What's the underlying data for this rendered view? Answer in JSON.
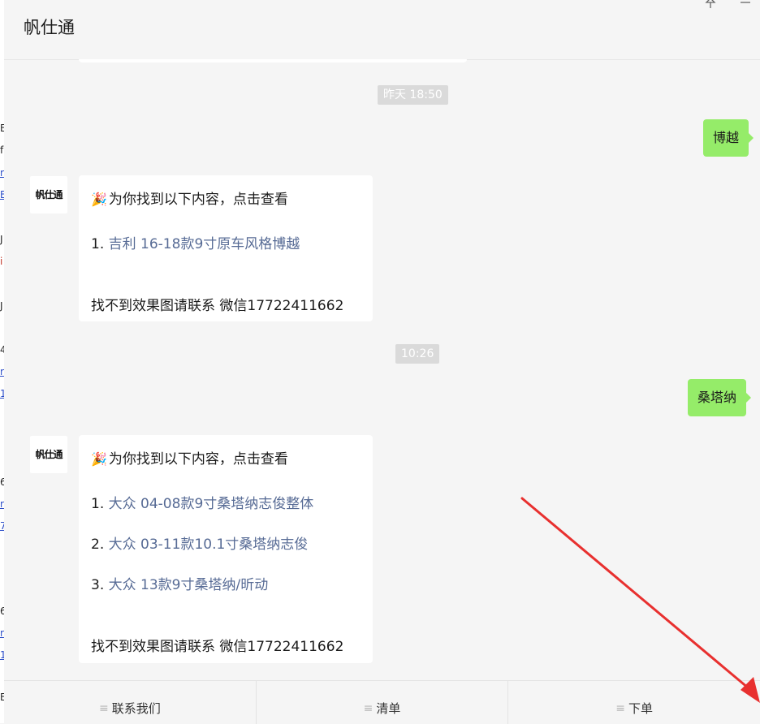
{
  "window": {
    "title": "帆仕通",
    "pin_icon": "pin-icon",
    "minimize_icon": "minimize-icon"
  },
  "left_strip": [
    {
      "text": "E",
      "style": "normal"
    },
    {
      "text": "f",
      "style": "normal"
    },
    {
      "text": "r",
      "style": "link"
    },
    {
      "text": "E",
      "style": "link"
    },
    {
      "text": "J",
      "style": "normal"
    },
    {
      "text": "i",
      "style": "red"
    },
    {
      "text": "J",
      "style": "normal"
    },
    {
      "text": "4",
      "style": "normal"
    },
    {
      "text": "r",
      "style": "link"
    },
    {
      "text": "1",
      "style": "link"
    },
    {
      "text": "6",
      "style": "normal"
    },
    {
      "text": "r",
      "style": "link"
    },
    {
      "text": "7",
      "style": "link"
    },
    {
      "text": "6",
      "style": "normal"
    },
    {
      "text": "r",
      "style": "link"
    },
    {
      "text": "1",
      "style": "link"
    },
    {
      "text": "E",
      "style": "normal"
    }
  ],
  "avatar_label": "帆仕通",
  "messages": {
    "time1": "昨天 18:50",
    "user1": "博越",
    "bot1": {
      "intro": "为你找到以下内容，点击查看",
      "items": [
        {
          "num": "1.",
          "text": "吉利 16-18款9寸原车风格博越"
        }
      ],
      "footer": "找不到效果图请联系 微信17722411662"
    },
    "time2": "10:26",
    "user2": "桑塔纳",
    "bot2": {
      "intro": "为你找到以下内容，点击查看",
      "items": [
        {
          "num": "1.",
          "text": "大众 04-08款9寸桑塔纳志俊整体"
        },
        {
          "num": "2.",
          "text": "大众 03-11款10.1寸桑塔纳志俊"
        },
        {
          "num": "3.",
          "text": "大众 13款9寸桑塔纳/昕动"
        }
      ],
      "footer": "找不到效果图请联系 微信17722411662"
    }
  },
  "menu": [
    {
      "label": "联系我们",
      "icon": "menu-lines-icon"
    },
    {
      "label": "清单",
      "icon": "menu-lines-icon"
    },
    {
      "label": "下单",
      "icon": "menu-lines-icon"
    }
  ],
  "colors": {
    "bubble": "#95ec69",
    "link": "#576b95",
    "arrow": "#e8302f"
  }
}
